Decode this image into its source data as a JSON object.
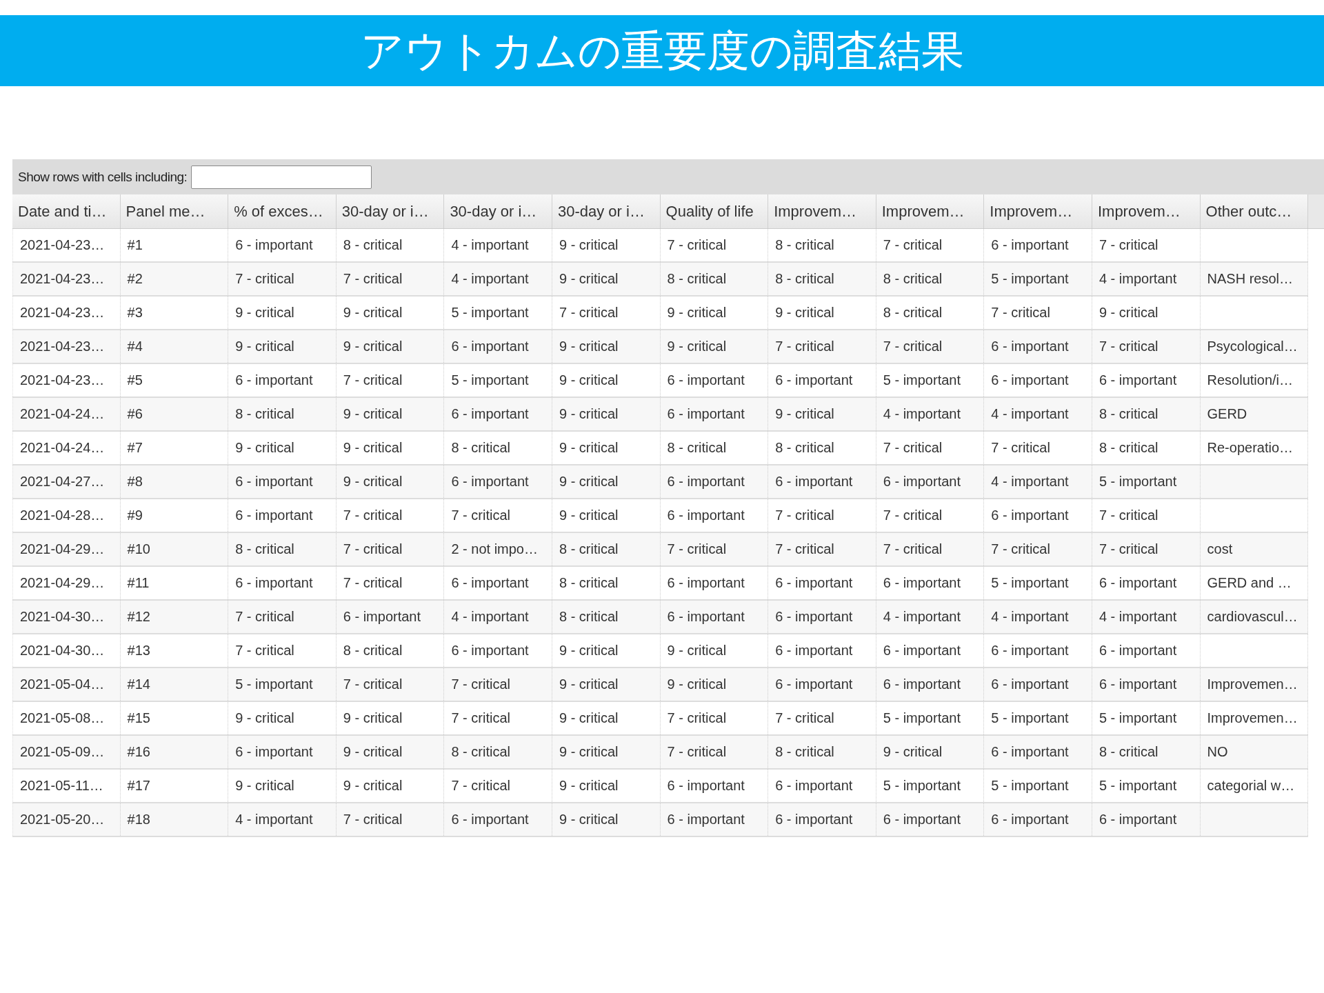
{
  "title": "アウトカムの重要度の調査結果",
  "filter": {
    "label": "Show rows with cells including:"
  },
  "table": {
    "columns": [
      "Date and ti…",
      "Panel me…",
      "% of exces…",
      "30-day or i…",
      "30-day or i…",
      "30-day or i…",
      "Quality of life",
      "Improvem…",
      "Improvem…",
      "Improvem…",
      "Improvem…",
      "Other outc…"
    ],
    "rows": [
      [
        "2021-04-23…",
        "#1",
        "6 - important",
        "8 - critical",
        "4 - important",
        "9 - critical",
        "7 - critical",
        "8 - critical",
        "7 - critical",
        "6 - important",
        "7 - critical",
        null
      ],
      [
        "2021-04-23…",
        "#2",
        "7 - critical",
        "7 - critical",
        "4 - important",
        "9 - critical",
        "8 - critical",
        "8 - critical",
        "8 - critical",
        "5 - important",
        "4 - important",
        "NASH resol…"
      ],
      [
        "2021-04-23…",
        "#3",
        "9 - critical",
        "9 - critical",
        "5 - important",
        "7 - critical",
        "9 - critical",
        "9 - critical",
        "8 - critical",
        "7 - critical",
        "9 - critical",
        null
      ],
      [
        "2021-04-23…",
        "#4",
        "9 - critical",
        "9 - critical",
        "6 - important",
        "9 - critical",
        "9 - critical",
        "7 - critical",
        "7 - critical",
        "6 - important",
        "7 - critical",
        "Psycological…"
      ],
      [
        "2021-04-23…",
        "#5",
        "6 - important",
        "7 - critical",
        "5 - important",
        "9 - critical",
        "6 - important",
        "6 - important",
        "5 - important",
        "6 - important",
        "6 - important",
        "Resolution/i…"
      ],
      [
        "2021-04-24…",
        "#6",
        "8 - critical",
        "9 - critical",
        "6 - important",
        "9 - critical",
        "6 - important",
        "9 - critical",
        "4 - important",
        "4 - important",
        "8 - critical",
        "GERD"
      ],
      [
        "2021-04-24…",
        "#7",
        "9 - critical",
        "9 - critical",
        "8 - critical",
        "9 - critical",
        "8 - critical",
        "8 - critical",
        "7 - critical",
        "7 - critical",
        "8 - critical",
        "Re-operatio…"
      ],
      [
        "2021-04-27…",
        "#8",
        "6 - important",
        "9 - critical",
        "6 - important",
        "9 - critical",
        "6 - important",
        "6 - important",
        "6 - important",
        "4 - important",
        "5 - important",
        null
      ],
      [
        "2021-04-28…",
        "#9",
        "6 - important",
        "7 - critical",
        "7 - critical",
        "9 - critical",
        "6 - important",
        "7 - critical",
        "7 - critical",
        "6 - important",
        "7 - critical",
        null
      ],
      [
        "2021-04-29…",
        "#10",
        "8 - critical",
        "7 - critical",
        "2 - not impo…",
        "8 - critical",
        "7 - critical",
        "7 - critical",
        "7 - critical",
        "7 - critical",
        "7 - critical",
        "cost"
      ],
      [
        "2021-04-29…",
        "#11",
        "6 - important",
        "7 - critical",
        "6 - important",
        "8 - critical",
        "6 - important",
        "6 - important",
        "6 - important",
        "5 - important",
        "6 - important",
        "GERD and …"
      ],
      [
        "2021-04-30…",
        "#12",
        "7 - critical",
        "6 - important",
        "4 - important",
        "8 - critical",
        "6 - important",
        "6 - important",
        "4 - important",
        "4 - important",
        "4 - important",
        "cardiovascul…"
      ],
      [
        "2021-04-30…",
        "#13",
        "7 - critical",
        "8 - critical",
        "6 - important",
        "9 - critical",
        "9 - critical",
        "6 - important",
        "6 - important",
        "6 - important",
        "6 - important",
        null
      ],
      [
        "2021-05-04…",
        "#14",
        "5 - important",
        "7 - critical",
        "7 - critical",
        "9 - critical",
        "9 - critical",
        "6 - important",
        "6 - important",
        "6 - important",
        "6 - important",
        "Improvemen…"
      ],
      [
        "2021-05-08…",
        "#15",
        "9 - critical",
        "9 - critical",
        "7 - critical",
        "9 - critical",
        "7 - critical",
        "7 - critical",
        "5 - important",
        "5 - important",
        "5 - important",
        "Improvemen…"
      ],
      [
        "2021-05-09…",
        "#16",
        "6 - important",
        "9 - critical",
        "8 - critical",
        "9 - critical",
        "7 - critical",
        "8 - critical",
        "9 - critical",
        "6 - important",
        "8 - critical",
        "NO"
      ],
      [
        "2021-05-11…",
        "#17",
        "9 - critical",
        "9 - critical",
        "7 - critical",
        "9 - critical",
        "6 - important",
        "6 - important",
        "5 - important",
        "5 - important",
        "5 - important",
        "categorial w…"
      ],
      [
        "2021-05-20…",
        "#18",
        "4 - important",
        "7 - critical",
        "6 - important",
        "9 - critical",
        "6 - important",
        "6 - important",
        "6 - important",
        "6 - important",
        "6 - important",
        null
      ]
    ]
  }
}
